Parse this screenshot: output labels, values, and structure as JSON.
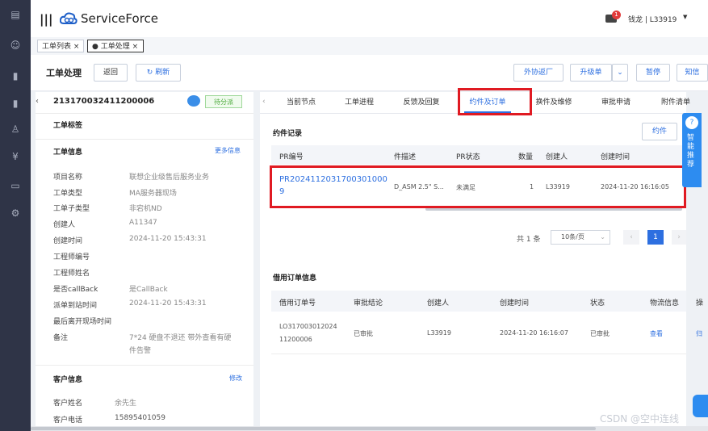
{
  "app": {
    "title": "ServiceForce",
    "user": "钱龙 | L33919",
    "notif_count": "1"
  },
  "tabs": [
    {
      "label": "工单列表"
    },
    {
      "label": "工单处理"
    }
  ],
  "toolbar": {
    "title": "工单处理",
    "back_label": "返回",
    "refresh_label": "刷新",
    "outsource_label": "外协返厂",
    "upgrade_label": "升级单",
    "pause_label": "暂停",
    "notify_label": "知信"
  },
  "ticket": {
    "number": "213170032411200006",
    "status": "待分派",
    "sections": {
      "tag": "工单标签",
      "info": "工单信息",
      "more": "更多信息",
      "customer": "客户信息",
      "edit": "修改"
    },
    "fields": [
      {
        "label": "项目名称",
        "value": "联想企业级售后服务业务"
      },
      {
        "label": "工单类型",
        "value": "MA服务器现场"
      },
      {
        "label": "工单子类型",
        "value": "非宕机ND"
      },
      {
        "label": "创建人",
        "value": "A11347"
      },
      {
        "label": "创建时间",
        "value": "2024-11-20 15:43:31"
      },
      {
        "label": "工程师编号",
        "value": ""
      },
      {
        "label": "工程师姓名",
        "value": ""
      },
      {
        "label": "是否callBack",
        "value": "是CallBack"
      },
      {
        "label": "派单到站时间",
        "value": "2024-11-20 15:43:31"
      },
      {
        "label": "最后离开现场时间",
        "value": ""
      },
      {
        "label": "备注",
        "value": "7*24 硬盘不退还 带外查看有硬",
        "value2": "件告警"
      }
    ],
    "customer": [
      {
        "label": "客户姓名",
        "value": "余先生"
      },
      {
        "label": "客户电话",
        "value": "15895401059"
      }
    ]
  },
  "detail_tabs": [
    "当前节点",
    "工单进程",
    "反馈及回复",
    "约件及订单",
    "换件及维修",
    "审批申请",
    "附件清单"
  ],
  "parts": {
    "title": "约件记录",
    "button": "约件",
    "headers": [
      "PR编号",
      "件描述",
      "PR状态",
      "数量",
      "创建人",
      "创建时间"
    ],
    "row": {
      "pr_line1": "PR2024112031700301000",
      "pr_line2": "9",
      "desc": "D_ASM 2.5\" S...",
      "status": "未满足",
      "qty": "1",
      "creator": "L33919",
      "time": "2024-11-20 16:16:05"
    },
    "pagination": {
      "total": "共 1 条",
      "size": "10条/页",
      "page": "1"
    }
  },
  "orders": {
    "title": "借用订单信息",
    "headers": [
      "借用订单号",
      "审批结论",
      "创建人",
      "创建时间",
      "状态",
      "物流信息",
      "操"
    ],
    "row": {
      "no_line1": "LO317003012024",
      "no_line2": "11200006",
      "result": "已审批",
      "creator": "L33919",
      "time": "2024-11-20 16:16:07",
      "status": "已审批",
      "logistics": "查看",
      "op": "归"
    }
  },
  "assistant": {
    "label": "智能推荐"
  },
  "watermark": "CSDN @空中连线"
}
